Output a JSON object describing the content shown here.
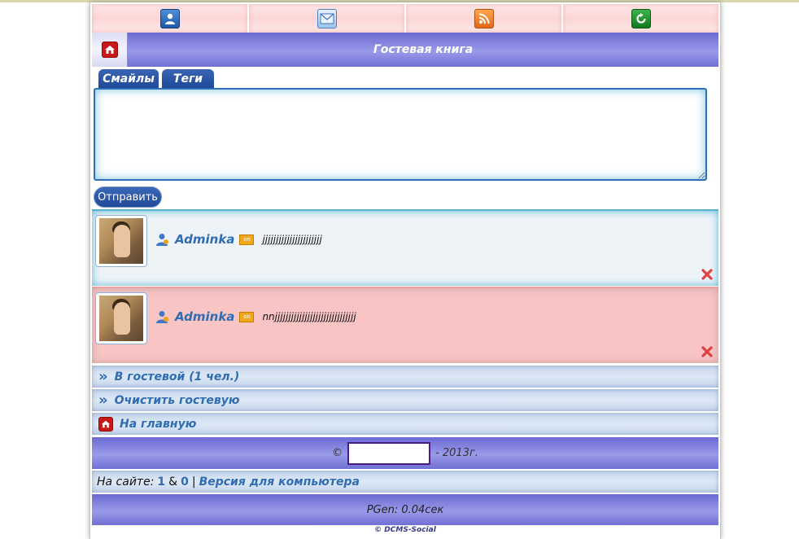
{
  "header": {
    "icons": [
      "profile-icon",
      "mail-icon",
      "rss-icon",
      "refresh-icon"
    ],
    "title": "Гостевая книга"
  },
  "tabs": [
    {
      "label": "Смайлы"
    },
    {
      "label": "Теги"
    }
  ],
  "form": {
    "message_value": "",
    "submit_label": "Отправить"
  },
  "posts": [
    {
      "user": "Adminka",
      "status": "on",
      "text": "jjjjjjjjjjjjjjjjjjjjjj"
    },
    {
      "user": "Adminka",
      "status": "on",
      "text": "nnjjjjjjjjjjjjjjjjjjjjjjjjjjjjjj"
    }
  ],
  "links": [
    {
      "label": "В гостевой (1 чел.)"
    },
    {
      "label": "Очистить гостевую"
    },
    {
      "label": "На главную"
    }
  ],
  "footer": {
    "copyright_prefix": "©",
    "copyright_suffix": "- 2013г.",
    "online_label": "На сайте:",
    "online_count_1": "1",
    "online_sep": "&",
    "online_count_2": "0",
    "divider": "|",
    "desktop_version": "Версия для компьютера",
    "pgen": "PGen: 0.04сек",
    "engine": "© DCMS-Social"
  },
  "colors": {
    "accent_blue": "#2f6cb2",
    "header_purple": "#7f7fe0",
    "post_alt_pink": "#f8c4c4"
  }
}
